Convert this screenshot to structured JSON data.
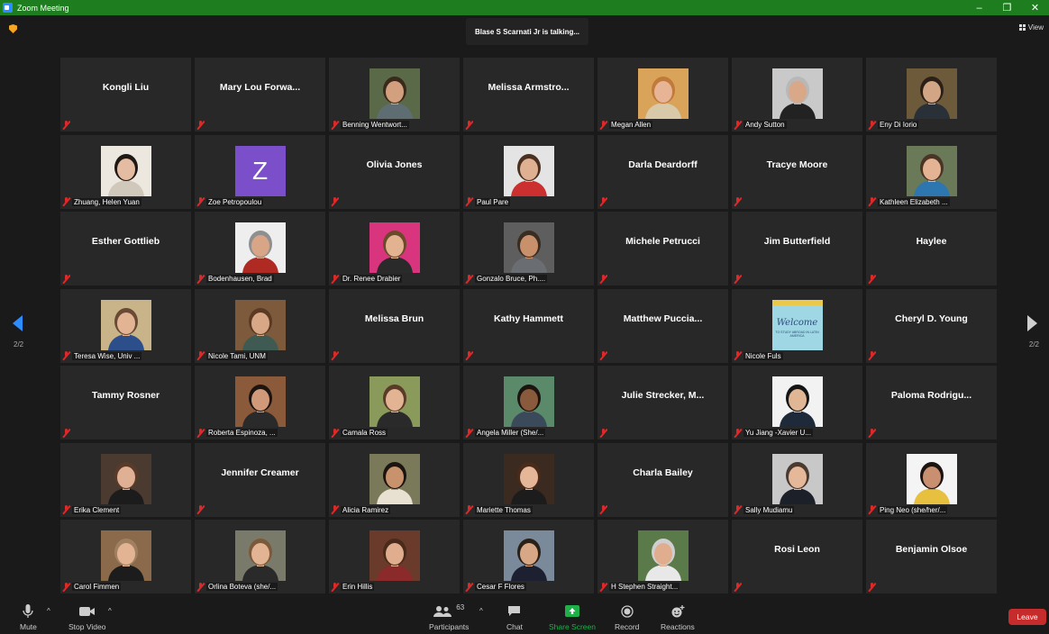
{
  "window": {
    "title": "Zoom Meeting",
    "controls": [
      "–",
      "❐",
      "✕"
    ]
  },
  "banner": {
    "talking": "Blase S Scarnati Jr is talking..."
  },
  "view_button": {
    "label": "View"
  },
  "pagination": {
    "left": "2/2",
    "right": "2/2"
  },
  "tiles": [
    {
      "name": "Kongli Liu",
      "type": "name",
      "label": ""
    },
    {
      "name": "Mary Lou Forwa...",
      "type": "name",
      "label": ""
    },
    {
      "name": "",
      "type": "photo",
      "label": "Benning Wentwort...",
      "bg": "#5a6a48",
      "skin": "#d2a07e",
      "hair": "#3a2a1c",
      "shirt": "#5d6d72"
    },
    {
      "name": "Melissa Armstro...",
      "type": "name",
      "label": ""
    },
    {
      "name": "",
      "type": "photo",
      "label": "Megan Allen",
      "bg": "#d9a35a",
      "skin": "#e7b596",
      "hair": "#c07a3a",
      "shirt": "#d8c9a8"
    },
    {
      "name": "",
      "type": "photo",
      "label": "Andy Sutton",
      "bg": "#c9c9c9",
      "skin": "#d8a888",
      "hair": "#b8b8b8",
      "shirt": "#222222"
    },
    {
      "name": "",
      "type": "photo",
      "label": "Eny Di Iorio",
      "bg": "#6d5a3a",
      "skin": "#d2a584",
      "hair": "#2a2017",
      "shirt": "#2a3038"
    },
    {
      "name": "",
      "type": "photo",
      "label": "Zhuang, Helen Yuan",
      "bg": "#ece7df",
      "skin": "#e3bca1",
      "hair": "#1f1814",
      "shirt": "#cfc8bb"
    },
    {
      "name": "",
      "type": "avatar",
      "avatar": "Z",
      "label": "Zoe Petropoulou"
    },
    {
      "name": "Olivia Jones",
      "type": "name",
      "label": ""
    },
    {
      "name": "",
      "type": "photo",
      "label": "Paul Pare",
      "bg": "#e4e4e4",
      "skin": "#e0b093",
      "hair": "#4a3020",
      "shirt": "#cc2f2f"
    },
    {
      "name": "Darla Deardorff",
      "type": "name",
      "label": ""
    },
    {
      "name": "Tracye Moore",
      "type": "name",
      "label": ""
    },
    {
      "name": "",
      "type": "photo",
      "label": "Kathleen Elizabeth ...",
      "bg": "#6a7a58",
      "skin": "#e3b393",
      "hair": "#4a3426",
      "shirt": "#2d76b0"
    },
    {
      "name": "Esther Gottlieb",
      "type": "name",
      "label": ""
    },
    {
      "name": "",
      "type": "photo",
      "label": "Bodenhausen, Brad",
      "bg": "#eeeeee",
      "skin": "#d8a686",
      "hair": "#8f8f8f",
      "shirt": "#b02a24"
    },
    {
      "name": "",
      "type": "photo",
      "label": "Dr. Renee Drabier",
      "bg": "#d9357f",
      "skin": "#e2b291",
      "hair": "#6b4a2a",
      "shirt": "#2a2a2a"
    },
    {
      "name": "",
      "type": "photo",
      "label": "Gonzalo Bruce, Ph....",
      "bg": "#5e5e5e",
      "skin": "#c8916c",
      "hair": "#3a2c20",
      "shirt": "#6a6e72"
    },
    {
      "name": "Michele Petrucci",
      "type": "name",
      "label": ""
    },
    {
      "name": "Jim Butterfield",
      "type": "name",
      "label": ""
    },
    {
      "name": "Haylee",
      "type": "name",
      "label": ""
    },
    {
      "name": "",
      "type": "photo",
      "label": "Teresa Wise, Univ ...",
      "bg": "#c8b488",
      "skin": "#e3b494",
      "hair": "#6a4a34",
      "shirt": "#2c4e8a"
    },
    {
      "name": "",
      "type": "photo",
      "label": "Nicole Tami, UNM",
      "bg": "#7d5a3c",
      "skin": "#d8a886",
      "hair": "#5a3a22",
      "shirt": "#3e5a52"
    },
    {
      "name": "Melissa Brun",
      "type": "name",
      "label": ""
    },
    {
      "name": "Kathy Hammett",
      "type": "name",
      "label": ""
    },
    {
      "name": "Matthew  Puccia...",
      "type": "name",
      "label": ""
    },
    {
      "name": "",
      "type": "welcome",
      "label": "Nicole Fuls",
      "welcome_title": "Welcome",
      "welcome_sub": "TO STUDY ABROAD IN LATIN AMERICA"
    },
    {
      "name": "Cheryl D. Young",
      "type": "name",
      "label": ""
    },
    {
      "name": "Tammy Rosner",
      "type": "name",
      "label": ""
    },
    {
      "name": "",
      "type": "photo",
      "label": "Roberta Espinoza, ...",
      "bg": "#8a5a3a",
      "skin": "#d09a7a",
      "hair": "#1c1410",
      "shirt": "#2a2a2a"
    },
    {
      "name": "",
      "type": "photo",
      "label": "Camala Ross",
      "bg": "#8a9a5a",
      "skin": "#e3b494",
      "hair": "#5a3a28",
      "shirt": "#2a2a2a"
    },
    {
      "name": "",
      "type": "photo",
      "label": "Angela Miller (She/...",
      "bg": "#5a8a6a",
      "skin": "#8a5a3c",
      "hair": "#1c1410",
      "shirt": "#3a4a5a"
    },
    {
      "name": "Julie  Strecker,  M...",
      "type": "name",
      "label": ""
    },
    {
      "name": "",
      "type": "photo",
      "label": "Yu Jiang -Xavier U...",
      "bg": "#f2f2f2",
      "skin": "#e0b694",
      "hair": "#151515",
      "shirt": "#1e2a3a"
    },
    {
      "name": "Paloma  Rodrigu...",
      "type": "name",
      "label": ""
    },
    {
      "name": "",
      "type": "photo",
      "label": "Erika Clement",
      "bg": "#4a3a30",
      "skin": "#e0b094",
      "hair": "#5a3a28",
      "shirt": "#1c1c1c"
    },
    {
      "name": "Jennifer Creamer",
      "type": "name",
      "label": ""
    },
    {
      "name": "",
      "type": "photo",
      "label": "Alicia Ramirez",
      "bg": "#7a7a5a",
      "skin": "#c8926c",
      "hair": "#1c1410",
      "shirt": "#e8e0d0"
    },
    {
      "name": "",
      "type": "photo",
      "label": "Mariette Thomas",
      "bg": "#3a2a20",
      "skin": "#e6b698",
      "hair": "#4a2a18",
      "shirt": "#1c1c1c"
    },
    {
      "name": "Charla Bailey",
      "type": "name",
      "label": ""
    },
    {
      "name": "",
      "type": "photo",
      "label": "Sally Mudiamu",
      "bg": "#c8c8c8",
      "skin": "#e6b89a",
      "hair": "#4a3a30",
      "shirt": "#1c2028"
    },
    {
      "name": "",
      "type": "photo",
      "label": "Ping Neo (she/her/...",
      "bg": "#f4f4f4",
      "skin": "#c89070",
      "hair": "#1c1410",
      "shirt": "#e8c040"
    },
    {
      "name": "",
      "type": "photo",
      "label": "Carol Fimmen",
      "bg": "#8a6a4a",
      "skin": "#e3b494",
      "hair": "#a08060",
      "shirt": "#1c1c1c"
    },
    {
      "name": "",
      "type": "photo",
      "label": "Orlina Boteva (she/...",
      "bg": "#7a7a6a",
      "skin": "#e3b494",
      "hair": "#7a5a3a",
      "shirt": "#2a2a2a"
    },
    {
      "name": "",
      "type": "photo",
      "label": "Erin Hillis",
      "bg": "#6a3a2a",
      "skin": "#e0ae8e",
      "hair": "#4a2a1a",
      "shirt": "#8a2a2a"
    },
    {
      "name": "",
      "type": "photo",
      "label": "Cesar F Flores",
      "bg": "#7a8a9a",
      "skin": "#d8a886",
      "hair": "#2a2018",
      "shirt": "#1c2030"
    },
    {
      "name": "",
      "type": "photo",
      "label": "H Stephen Straight...",
      "bg": "#5a7a4a",
      "skin": "#e0ae8e",
      "hair": "#cfcfcf",
      "shirt": "#e8e8e8"
    },
    {
      "name": "Rosi Leon",
      "type": "name",
      "label": ""
    },
    {
      "name": "Benjamin Olsoe",
      "type": "name",
      "label": ""
    }
  ],
  "toolbar": {
    "mute": "Mute",
    "stop_video": "Stop Video",
    "participants": "Participants",
    "participants_count": "63",
    "chat": "Chat",
    "share_screen": "Share Screen",
    "record": "Record",
    "reactions": "Reactions",
    "leave": "Leave"
  },
  "colors": {
    "title_bar": "#1e7d1e",
    "share_green": "#1fb04a",
    "leave_red": "#c72c2c",
    "mute_red": "#e02828",
    "nav_blue": "#2d8cff"
  }
}
